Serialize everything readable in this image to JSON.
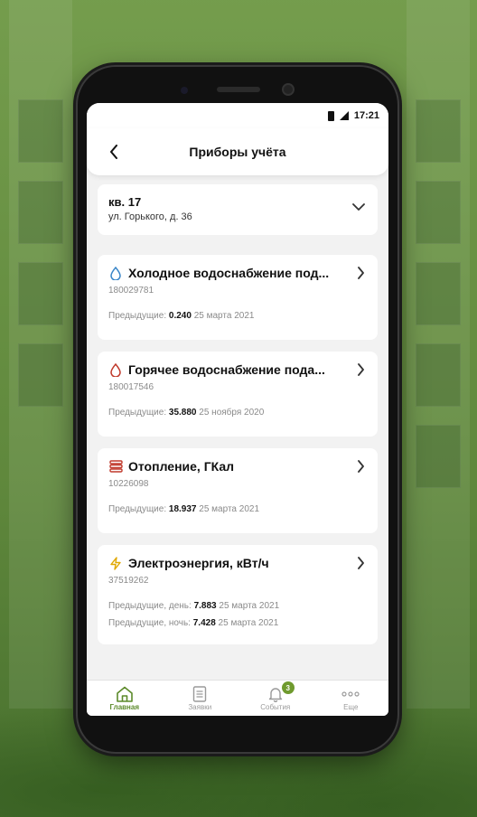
{
  "status": {
    "time": "17:21"
  },
  "header": {
    "title": "Приборы учёта"
  },
  "address": {
    "apartment": "кв. 17",
    "street": "ул. Горького, д. 36"
  },
  "meters": [
    {
      "icon": "water-drop-blue-icon",
      "title": "Холодное водоснабжение под...",
      "serial": "180029781",
      "prev_label": "Предыдущие:",
      "prev_value": "0.240",
      "prev_date": "25 марта 2021"
    },
    {
      "icon": "water-drop-red-icon",
      "title": "Горячее водоснабжение пода...",
      "serial": "180017546",
      "prev_label": "Предыдущие:",
      "prev_value": "35.880",
      "prev_date": "25 ноября 2020"
    },
    {
      "icon": "heating-radiator-icon",
      "title": "Отопление, ГКал",
      "serial": "10226098",
      "prev_label": "Предыдущие:",
      "prev_value": "18.937",
      "prev_date": "25 марта 2021"
    },
    {
      "icon": "lightning-icon",
      "title": "Электроэнергия, кВт/ч",
      "serial": "37519262",
      "prev_day_label": "Предыдущие, день:",
      "prev_day_value": "7.883",
      "prev_day_date": "25 марта 2021",
      "prev_night_label": "Предыдущие, ночь:",
      "prev_night_value": "7.428",
      "prev_night_date": "25 марта 2021"
    }
  ],
  "nav": [
    {
      "label": "Главная",
      "icon": "home-icon",
      "active": true
    },
    {
      "label": "Заявки",
      "icon": "document-icon"
    },
    {
      "label": "События",
      "icon": "bell-icon",
      "badge": "3"
    },
    {
      "label": "Еще",
      "icon": "more-icon"
    }
  ],
  "colors": {
    "accent": "#5c8a2a",
    "cold": "#3a86c8",
    "hot": "#c0392b",
    "heat": "#c0392b",
    "power": "#e0a800"
  }
}
